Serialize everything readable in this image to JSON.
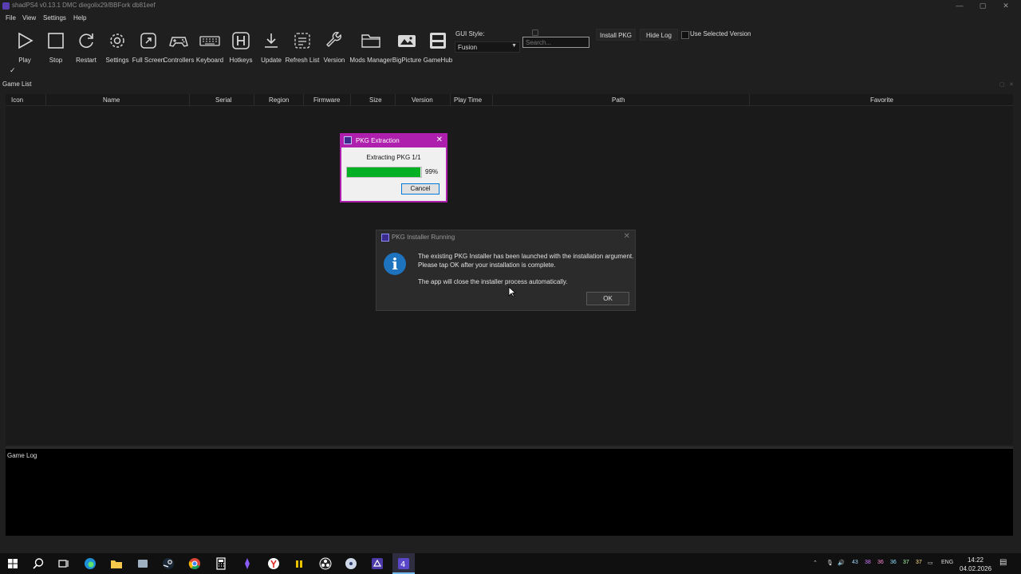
{
  "window": {
    "title": "shadPS4 v0.13.1 DMC diegolix29/BBFork db81eef",
    "controls": [
      "—",
      "▢",
      "✕"
    ]
  },
  "menubar": [
    "File",
    "View",
    "Settings",
    "Help"
  ],
  "toolbar": {
    "buttons": [
      {
        "label": "Play",
        "icon": "play-icon"
      },
      {
        "label": "Stop",
        "icon": "stop-icon"
      },
      {
        "label": "Restart",
        "icon": "restart-icon"
      },
      {
        "label": "Settings",
        "icon": "gear-icon"
      },
      {
        "label": "Full Screen",
        "icon": "fullscreen-icon"
      },
      {
        "label": "Controllers",
        "icon": "gamepad-icon"
      },
      {
        "label": "Keyboard",
        "icon": "keyboard-icon"
      },
      {
        "label": "Hotkeys",
        "icon": "hotkeys-icon"
      },
      {
        "label": "Update",
        "icon": "download-icon"
      },
      {
        "label": "Refresh List",
        "icon": "refresh-list-icon"
      },
      {
        "label": "Version",
        "icon": "wrench-icon"
      },
      {
        "label": "Mods Manager",
        "icon": "folder-icon"
      },
      {
        "label": "BigPicture",
        "icon": "image-icon"
      },
      {
        "label": "GameHub",
        "icon": "gamehub-icon"
      }
    ],
    "checkmark": "✓",
    "gui_style_label": "GUI Style:",
    "gui_style_value": "Fusion",
    "search_placeholder": "Search...",
    "install_pkg": "Install PKG",
    "hide_log": "Hide Log",
    "use_selected_version": "Use Selected Version"
  },
  "game_list": {
    "title": "Game List",
    "columns": [
      "Icon",
      "Name",
      "Serial",
      "Region",
      "Firmware",
      "Size",
      "Version",
      "Play Time",
      "Path",
      "Favorite"
    ]
  },
  "game_log": {
    "title": "Game Log"
  },
  "pkg_extraction": {
    "title": "PKG Extraction",
    "status": "Extracting PKG 1/1",
    "progress": 0.99,
    "progress_text": "99%",
    "cancel": "Cancel",
    "accent": "#ae1fae",
    "bar_color": "#06b025"
  },
  "installer_dialog": {
    "title": "PKG Installer Running",
    "line1": "The existing PKG Installer has been launched with the installation argument.",
    "line2": "Please tap OK after your installation is complete.",
    "line3": "The app will close the installer process automatically.",
    "ok": "OK"
  },
  "taskbar": {
    "tray_numbers": [
      "43",
      "38",
      "36",
      "36",
      "37",
      "37"
    ],
    "language": "ENG",
    "time": "14:22",
    "date": "04.02.2026"
  }
}
